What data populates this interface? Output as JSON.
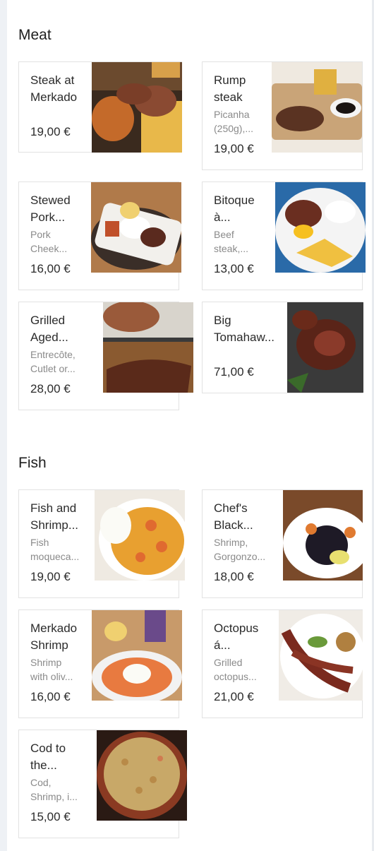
{
  "sections": [
    {
      "title": "Meat",
      "items": [
        {
          "name_lines": [
            "Steak at",
            "Merkado"
          ],
          "desc_lines": [],
          "price": "19,00 €",
          "image": "grilled-steak-platter"
        },
        {
          "name_lines": [
            "Rump",
            "steak"
          ],
          "desc_lines": [
            "Picanha",
            "(250g),..."
          ],
          "price": "19,00 €",
          "image": "rump-steak-board"
        },
        {
          "name_lines": [
            "Stewed",
            "Pork..."
          ],
          "desc_lines": [
            "Pork",
            "Cheek..."
          ],
          "price": "16,00 €",
          "image": "stewed-pork-rice"
        },
        {
          "name_lines": [
            "Bitoque",
            "à..."
          ],
          "desc_lines": [
            "Beef",
            "steak,..."
          ],
          "price": "13,00 €",
          "image": "bitoque-fries-egg"
        },
        {
          "name_lines": [
            "Grilled",
            "Aged..."
          ],
          "desc_lines": [
            "Entrecôte,",
            "Cutlet or..."
          ],
          "price": "28,00 €",
          "image": "grilled-aged-beef"
        },
        {
          "name_lines": [
            "Big",
            "Tomahaw..."
          ],
          "desc_lines": [],
          "price": "71,00 €",
          "image": "tomahawk-steak"
        }
      ]
    },
    {
      "title": "Fish",
      "items": [
        {
          "name_lines": [
            "Fish and",
            "Shrimp..."
          ],
          "desc_lines": [
            "Fish",
            "moqueca..."
          ],
          "price": "19,00 €",
          "image": "fish-shrimp-moqueca"
        },
        {
          "name_lines": [
            "Chef's",
            "Black..."
          ],
          "desc_lines": [
            "Shrimp,",
            "Gorgonzo..."
          ],
          "price": "18,00 €",
          "image": "black-rice-shrimp"
        },
        {
          "name_lines": [
            "Merkado",
            "Shrimp"
          ],
          "desc_lines": [
            "Shrimp",
            "with oliv..."
          ],
          "price": "16,00 €",
          "image": "merkado-shrimp-rice"
        },
        {
          "name_lines": [
            "Octopus",
            "á..."
          ],
          "desc_lines": [
            "Grilled",
            "octopus..."
          ],
          "price": "21,00 €",
          "image": "grilled-octopus"
        },
        {
          "name_lines": [
            "Cod to",
            "the..."
          ],
          "desc_lines": [
            "Cod,",
            "Shrimp, i..."
          ],
          "price": "15,00 €",
          "image": "cod-gratin-dish"
        }
      ]
    }
  ]
}
